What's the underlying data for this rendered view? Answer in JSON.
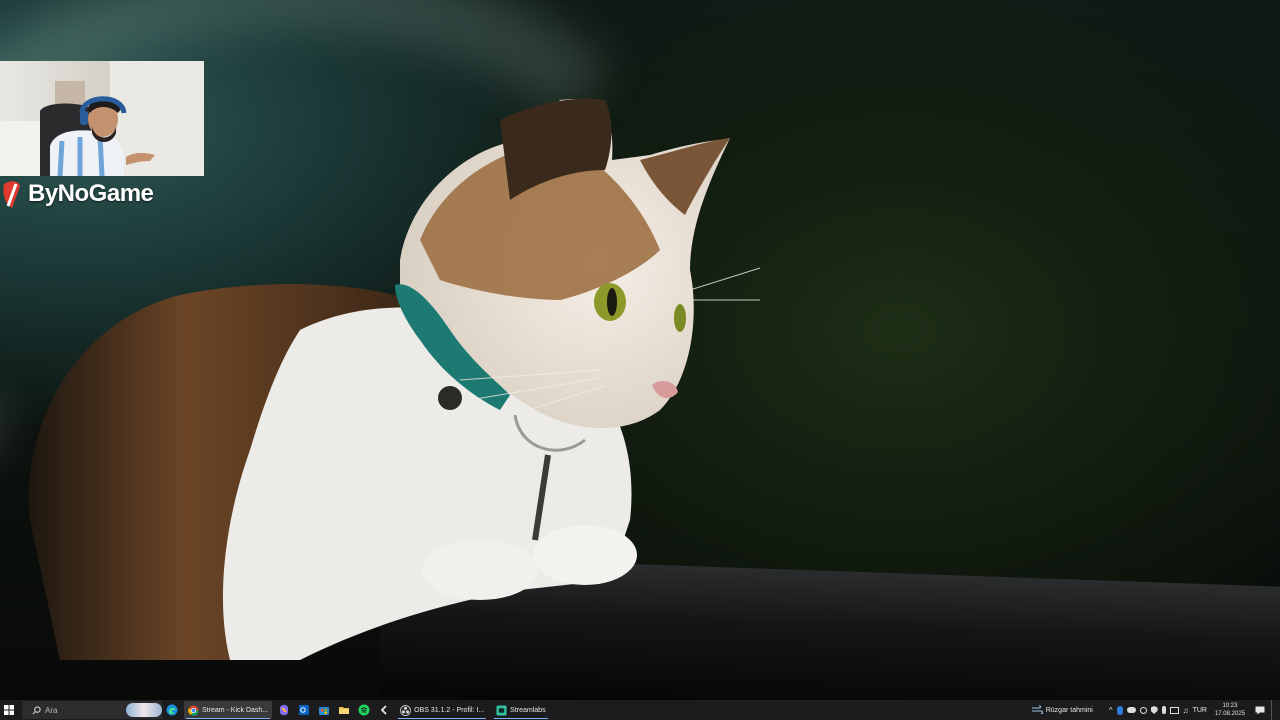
{
  "overlay": {
    "logo_text": "ByNoGame",
    "brand_color": "#e23a2e"
  },
  "taskbar": {
    "search_placeholder": "Ara",
    "pinned_icons": [
      "start-icon",
      "edge-icon",
      "copilot-icon",
      "outlook-icon",
      "store-icon",
      "file-explorer-icon",
      "spotify-icon",
      "app-icon"
    ],
    "apps": [
      {
        "label": "Stream - Kick Dash...",
        "icon": "chrome-icon",
        "active": true
      },
      {
        "label": "OBS 31.1.2 - Profil: I...",
        "icon": "obs-icon",
        "active": false
      },
      {
        "label": "Streamlabs",
        "icon": "streamlabs-icon",
        "active": false
      }
    ],
    "weather_text": "Rüzgar tahmini",
    "language": "TUR",
    "time": "10:23",
    "date": "17.08.2025"
  }
}
